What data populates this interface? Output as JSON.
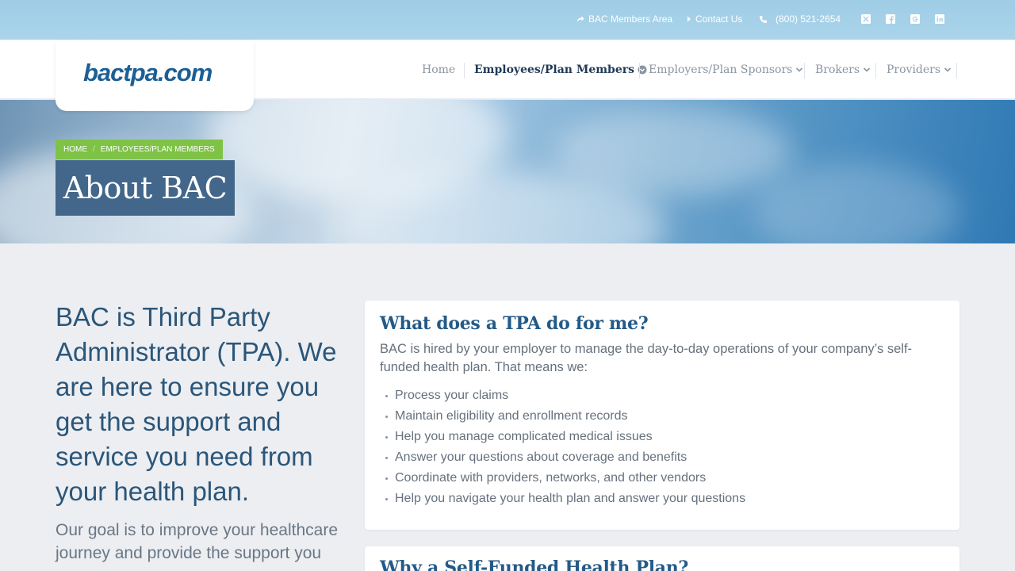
{
  "topbar": {
    "members_area": "BAC Members Area",
    "contact_us": "Contact Us",
    "phone": "(800) 521-2654",
    "social": [
      "x-twitter-icon",
      "facebook-icon",
      "google-icon",
      "linkedin-icon"
    ]
  },
  "header": {
    "logo_text": "bactpa.com",
    "nav": [
      {
        "label": "Home",
        "active": false,
        "dropdown": false
      },
      {
        "label": "Employees/Plan Members",
        "active": true,
        "dropdown": true
      },
      {
        "label": "Employers/Plan Sponsors",
        "active": false,
        "dropdown": true
      },
      {
        "label": "Brokers",
        "active": false,
        "dropdown": true
      },
      {
        "label": "Providers",
        "active": false,
        "dropdown": true
      }
    ]
  },
  "hero": {
    "breadcrumb": [
      "HOME",
      "EMPLOYEES/PLAN MEMBERS"
    ],
    "breadcrumb_sep": "/",
    "title": "About BAC"
  },
  "intro": {
    "heading": "BAC is Third Party Administrator (TPA). We are here to ensure you get the support and service you need from your health plan.",
    "subtext": "Our goal is to improve your healthcare journey and provide the support you"
  },
  "cards": [
    {
      "title": "What does a TPA do for me?",
      "body": "BAC is hired by your employer to manage the day-to-day operations of your company’s self-funded health plan. That means we:",
      "items": [
        "Process your claims",
        "Maintain eligibility and enrollment records",
        "Help you manage complicated medical issues",
        "Answer your questions about coverage and benefits",
        "Coordinate with providers, networks, and other vendors",
        "Help you navigate your health plan and answer your questions"
      ]
    },
    {
      "title": "Why a Self-Funded Health Plan?"
    }
  ],
  "colors": {
    "topbar": "#aad4ea",
    "brand": "#1c5f95",
    "breadcrumb_bg": "#7ec246",
    "title_bg": "#43678a",
    "card_heading": "#245a87"
  }
}
